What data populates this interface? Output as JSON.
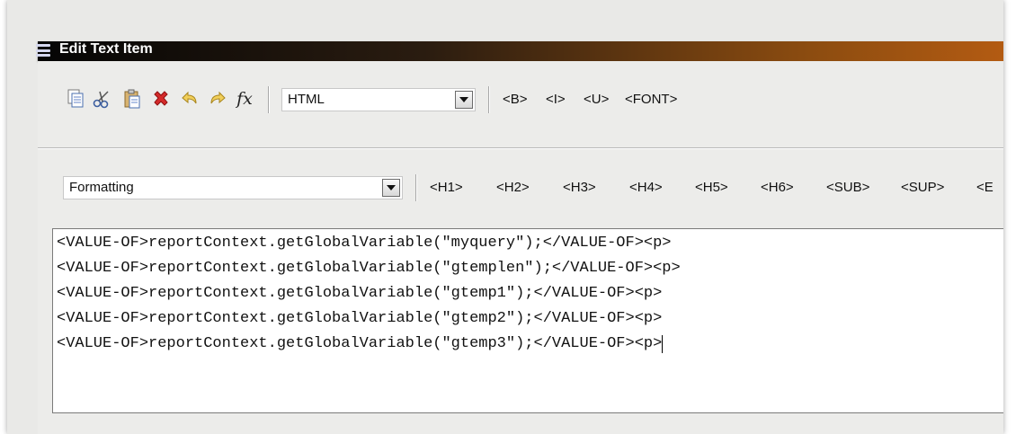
{
  "window": {
    "title": "Edit Text Item"
  },
  "toolbar1": {
    "icons": [
      "copy-icon",
      "cut-icon",
      "paste-icon",
      "delete-icon",
      "undo-icon",
      "redo-icon",
      "function-icon"
    ],
    "function_label": "fx",
    "format_select": {
      "value": "HTML"
    },
    "tags": [
      "<B>",
      "<I>",
      "<U>",
      "<FONT>"
    ]
  },
  "toolbar2": {
    "formatting_select": {
      "value": "Formatting"
    },
    "tags": [
      "<H1>",
      "<H2>",
      "<H3>",
      "<H4>",
      "<H5>",
      "<H6>",
      "<SUB>",
      "<SUP>",
      "<E"
    ]
  },
  "editor": {
    "lines": [
      "<VALUE-OF>reportContext.getGlobalVariable(\"myquery\");</VALUE-OF><p>",
      "<VALUE-OF>reportContext.getGlobalVariable(\"gtemplen\");</VALUE-OF><p>",
      "<VALUE-OF>reportContext.getGlobalVariable(\"gtemp1\");</VALUE-OF><p>",
      "<VALUE-OF>reportContext.getGlobalVariable(\"gtemp2\");</VALUE-OF><p>",
      "<VALUE-OF>reportContext.getGlobalVariable(\"gtemp3\");</VALUE-OF><p>"
    ]
  },
  "colors": {
    "titlebar_start": "#050505",
    "titlebar_end": "#b35b12",
    "panel_bg": "#ececea",
    "editor_bg": "#ffffff"
  }
}
